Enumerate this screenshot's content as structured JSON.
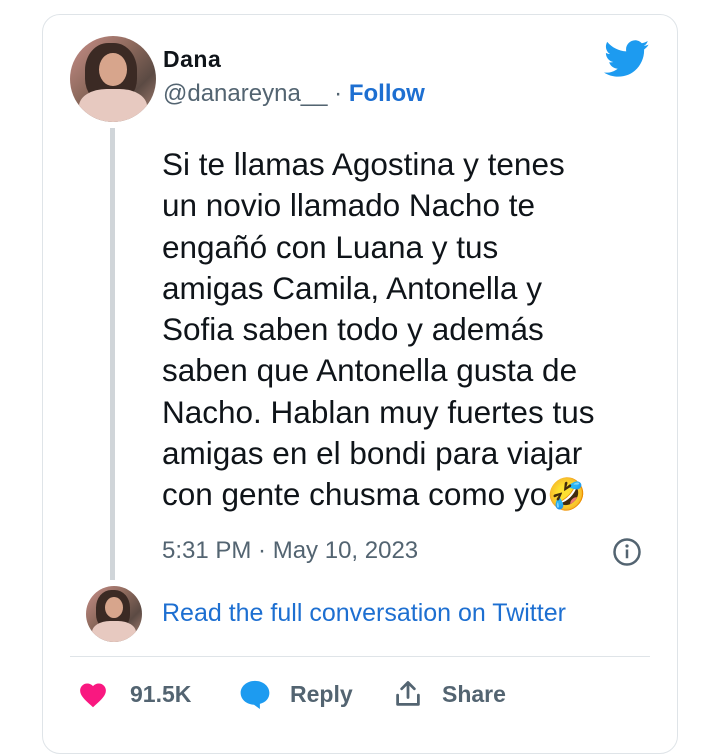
{
  "tweet": {
    "author_name": "Dana",
    "handle": "@danareyna__",
    "separator": "·",
    "follow_label": "Follow",
    "text_lines": [
      "Si te llamas Agostina y tenes",
      "un novio llamado Nacho te",
      "engañó con Luana y tus",
      "amigas Camila, Antonella y",
      "Sofia saben todo y además",
      "saben que Antonella gusta de",
      "Nacho. Hablan muy fuertes tus",
      "amigas en el bondi para viajar",
      "con gente chusma como yo🤣"
    ],
    "timestamp": "5:31 PM · May 10, 2023",
    "read_full_label": "Read the full conversation on Twitter"
  },
  "actions": {
    "like_count": "91.5K",
    "reply_label": "Reply",
    "share_label": "Share"
  },
  "colors": {
    "twitter_blue": "#1d9bf0",
    "link_blue": "#1d6fd1",
    "like_pink": "#f91880",
    "reply_blue": "#1d9bf0",
    "text_gray": "#536471"
  },
  "icons": [
    "twitter-bird-icon",
    "info-icon",
    "heart-icon",
    "reply-bubble-icon",
    "share-icon"
  ]
}
